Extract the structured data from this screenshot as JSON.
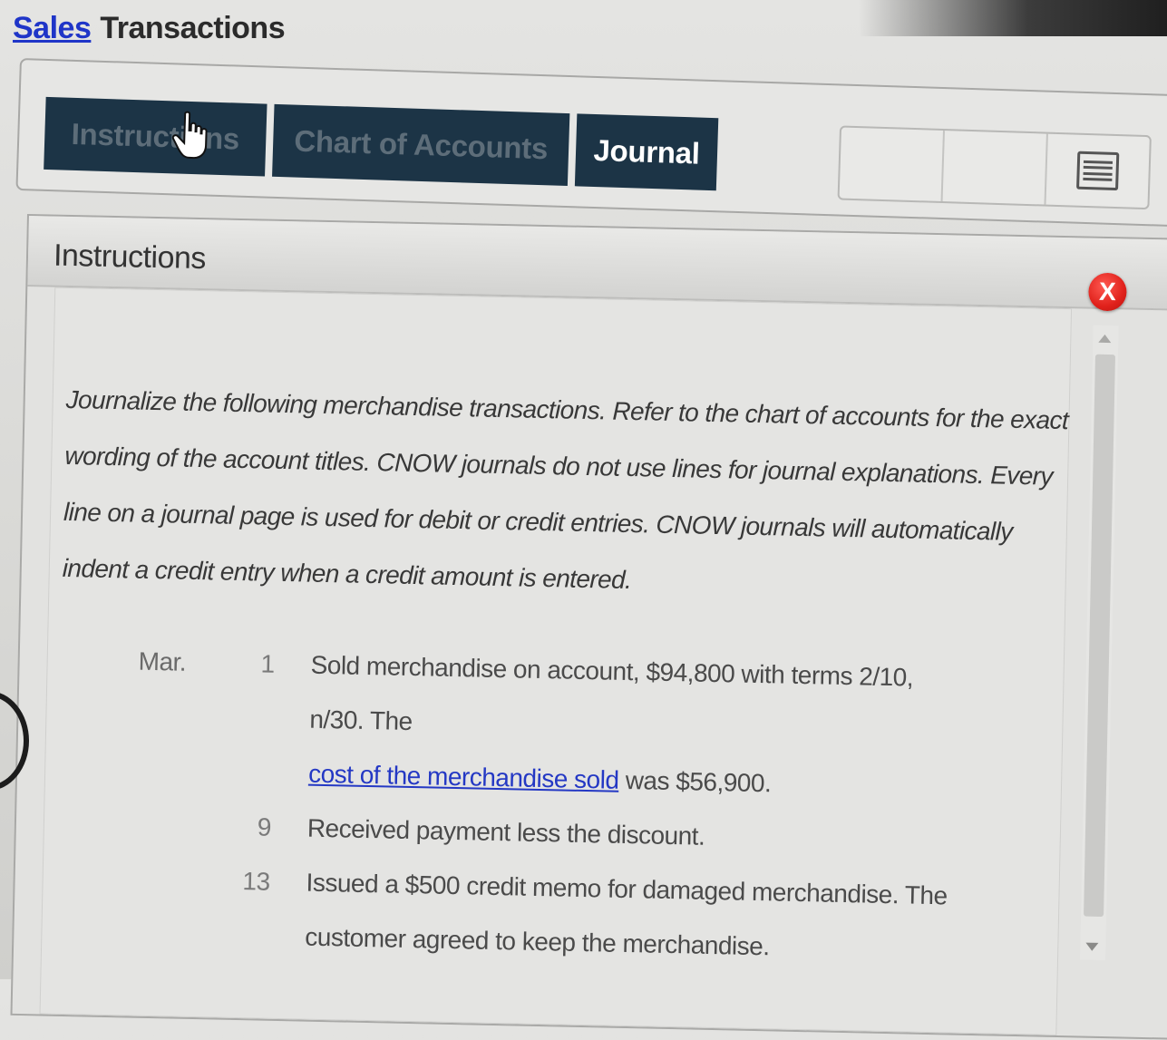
{
  "page": {
    "title_link": "Sales",
    "title_rest": "Transactions"
  },
  "tabs": [
    {
      "label": "Instructions"
    },
    {
      "label": "Chart of Accounts"
    },
    {
      "label": "Journal"
    }
  ],
  "toolbar": {
    "menu_icon": "menu-icon"
  },
  "panel": {
    "title": "Instructions",
    "close_label": "X",
    "instruction_text": "Journalize the following merchandise transactions. Refer to the chart of accounts for the exact wording of the account titles. CNOW journals do not use lines for journal explanations. Every line on a journal page is used for debit or credit entries. CNOW journals will automatically indent a credit entry when a credit amount is entered."
  },
  "transactions": [
    {
      "month": "Mar.",
      "day": "1",
      "text_before": "Sold merchandise on account, $94,800 with terms 2/10, n/30. The",
      "link_text": "cost of the merchandise sold",
      "text_after": " was $56,900."
    },
    {
      "month": "",
      "day": "9",
      "text_before": "Received payment less the discount.",
      "link_text": "",
      "text_after": ""
    },
    {
      "month": "",
      "day": "13",
      "text_before": "Issued a $500 credit memo for damaged merchandise. The customer agreed to keep the merchandise.",
      "link_text": "",
      "text_after": ""
    }
  ],
  "colors": {
    "tab_bg": "#1c3446",
    "link": "#1f35c8",
    "close": "#e0211b"
  }
}
